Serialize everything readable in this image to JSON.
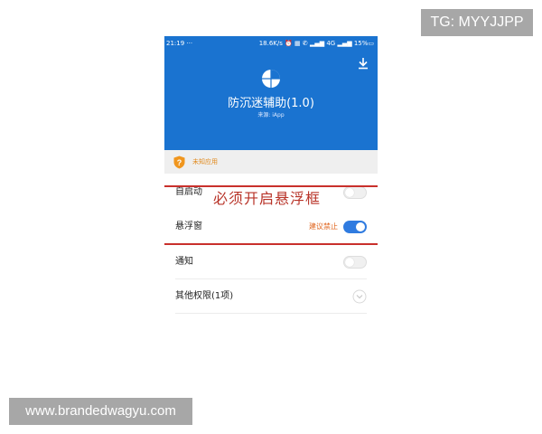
{
  "watermarks": {
    "tg": "TG: MYYJJPP",
    "site": "www.brandedwagyu.com"
  },
  "status_bar": {
    "time": "21:19 ···",
    "right": "18.6K/s ⏰ ▦ ✆ ▂▄▆ 4G ▂▄▆ 15%▭"
  },
  "app": {
    "title": "防沉迷辅助(1.0)",
    "source": "来源: iApp"
  },
  "warning": {
    "text": "未知应用",
    "icon_glyph": "?"
  },
  "permissions": [
    {
      "label": "自启动",
      "state": "off"
    },
    {
      "label": "悬浮窗",
      "state": "on",
      "note": "建议禁止"
    },
    {
      "label": "通知",
      "state": "off"
    },
    {
      "label": "其他权限(1项)",
      "state": "expand"
    }
  ],
  "annotation": {
    "text": "必须开启悬浮框",
    "color": "#c9302c"
  },
  "colors": {
    "header": "#1a73d0",
    "toggle_on": "#2f7be0",
    "warning": "#e08a1e"
  }
}
